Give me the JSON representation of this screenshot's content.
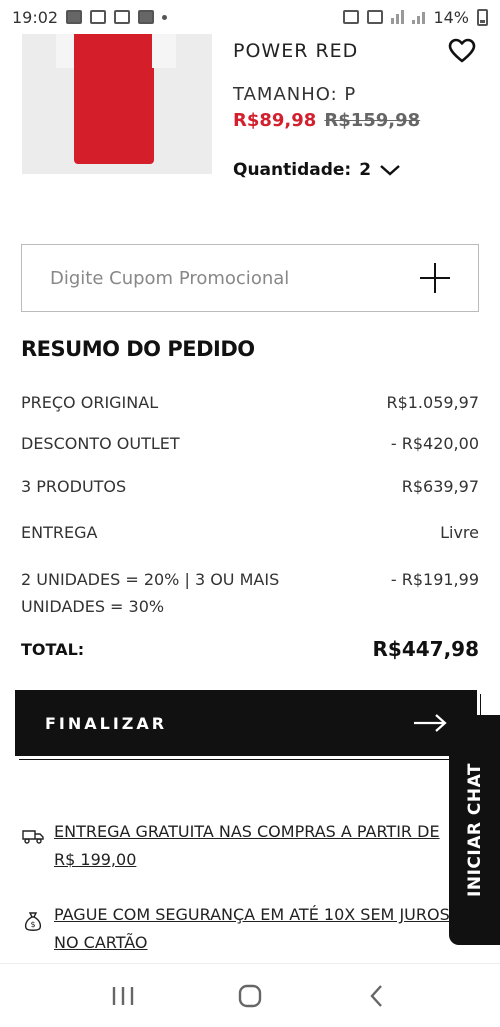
{
  "status_bar": {
    "time": "19:02",
    "battery": "14%"
  },
  "product": {
    "name": "POWER RED",
    "size": "TAMANHO: P",
    "sale_price": "R$89,98",
    "original_price": "R$159,98",
    "quantity_label": "Quantidade:",
    "quantity_value": "2"
  },
  "coupon": {
    "placeholder": "Digite Cupom Promocional"
  },
  "summary": {
    "title": "RESUMO DO PEDIDO",
    "rows": [
      {
        "label": "PREÇO ORIGINAL",
        "value": "R$1.059,97"
      },
      {
        "label": "DESCONTO OUTLET",
        "value": "- R$420,00"
      },
      {
        "label": "3 PRODUTOS",
        "value": "R$639,97"
      },
      {
        "label": "ENTREGA",
        "value": "Livre"
      },
      {
        "label": "2 UNIDADES = 20% | 3 OU MAIS UNIDADES = 30%",
        "value": "- R$191,99"
      }
    ],
    "total_label": "TOTAL:",
    "total_value": "R$447,98"
  },
  "checkout": {
    "label": "FINALIZAR"
  },
  "chat": {
    "label": "INICIAR CHAT"
  },
  "info": {
    "shipping": "ENTREGA GRATUITA NAS COMPRAS A PARTIR DE R$ 199,00",
    "payment": "PAGUE COM SEGURANÇA EM ATÉ 10X SEM JUROS NO CARTÃO"
  },
  "colors": {
    "sale_red": "#d2202e",
    "button_black": "#111111"
  },
  "icons": [
    "heart-icon",
    "chevron-down-icon",
    "plus-icon",
    "arrow-right-icon",
    "truck-icon",
    "money-bag-icon",
    "recents-icon",
    "home-icon",
    "back-icon"
  ]
}
